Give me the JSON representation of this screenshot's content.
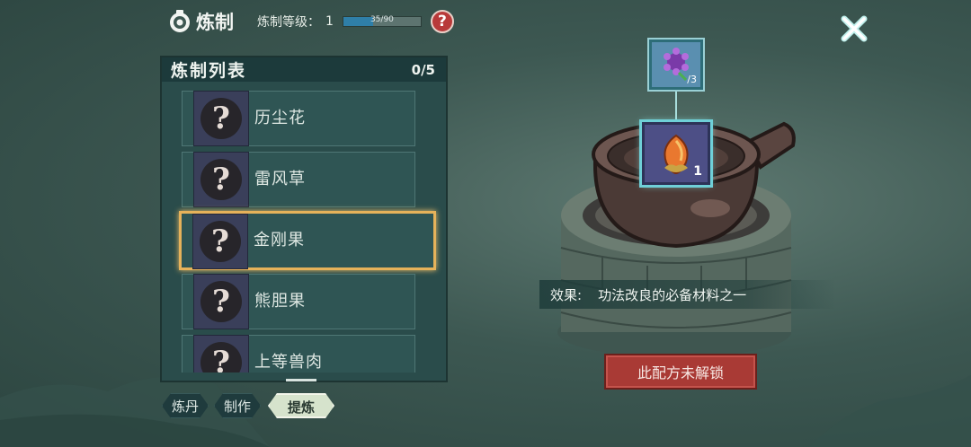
{
  "header": {
    "title": "炼制",
    "level_label": "炼制等级：",
    "level_value": "1",
    "progress_text": "35/90",
    "progress_fraction": 0.389,
    "help_glyph": "?"
  },
  "list_panel": {
    "title": "炼制列表",
    "count": "0/5",
    "items": [
      {
        "name": "历尘花",
        "icon": "question-mark-icon",
        "selected": false
      },
      {
        "name": "雷风草",
        "icon": "question-mark-icon",
        "selected": false
      },
      {
        "name": "金刚果",
        "icon": "question-mark-icon",
        "selected": true
      },
      {
        "name": "熊胆果",
        "icon": "question-mark-icon",
        "selected": false
      },
      {
        "name": "上等兽肉",
        "icon": "question-mark-icon",
        "selected": false
      }
    ],
    "placeholder_glyph": "?"
  },
  "tabs": [
    {
      "label": "炼丹",
      "active": false
    },
    {
      "label": "制作",
      "active": false
    },
    {
      "label": "提炼",
      "active": true
    }
  ],
  "recipe": {
    "ingredient_count": "/3",
    "product_count": "1",
    "ingredient_icon": "purple-spiky-herb-icon",
    "product_icon": "golden-fruit-icon",
    "effect_label": "效果:",
    "effect_text": "功法改良的必备材料之一",
    "unlock_button": "此配方未解锁"
  },
  "colors": {
    "accent_selected": "#e6b25a",
    "button_red": "#a93a35",
    "progress_fill": "#2f7fa8",
    "slot_glow": "#6fd0d8"
  }
}
